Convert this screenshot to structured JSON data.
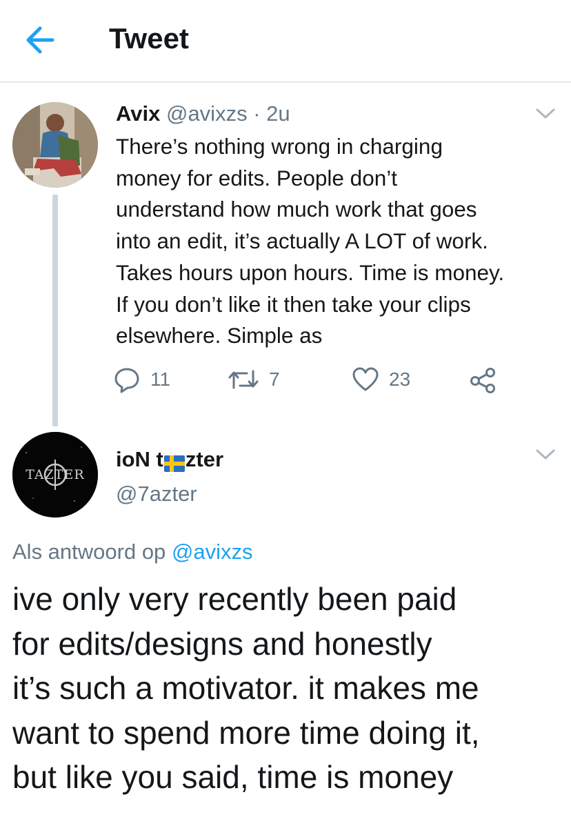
{
  "header": {
    "title": "Tweet",
    "back_icon": "arrow-left-icon",
    "accent_color": "#1da1f2"
  },
  "tweet1": {
    "name": "Avix",
    "handle": "@avixzs",
    "separator": "·",
    "time": "2u",
    "text_lines": [
      "There’s nothing wrong in charging",
      "money for edits. People don’t",
      "understand how much work that goes",
      "into an edit, it’s actually A LOT of work.",
      "Takes hours upon hours. Time is money.",
      "If you don’t like it then take your clips",
      "elsewhere. Simple as"
    ],
    "replies": "11",
    "retweets": "7",
    "likes": "23"
  },
  "tweet2": {
    "name_prefix": "ioN t",
    "name_flag": "sweden-flag-icon",
    "name_suffix": "zter",
    "handle": "@7azter",
    "avatar_text": "TAZTER",
    "reply_prefix": "Als antwoord op",
    "reply_to": "@avixzs",
    "text_lines": [
      "ive only very recently been paid",
      "for edits/designs and honestly",
      "it’s such a motivator. it makes me",
      "want to spend more time doing it,",
      "but like you said, time is money"
    ]
  }
}
